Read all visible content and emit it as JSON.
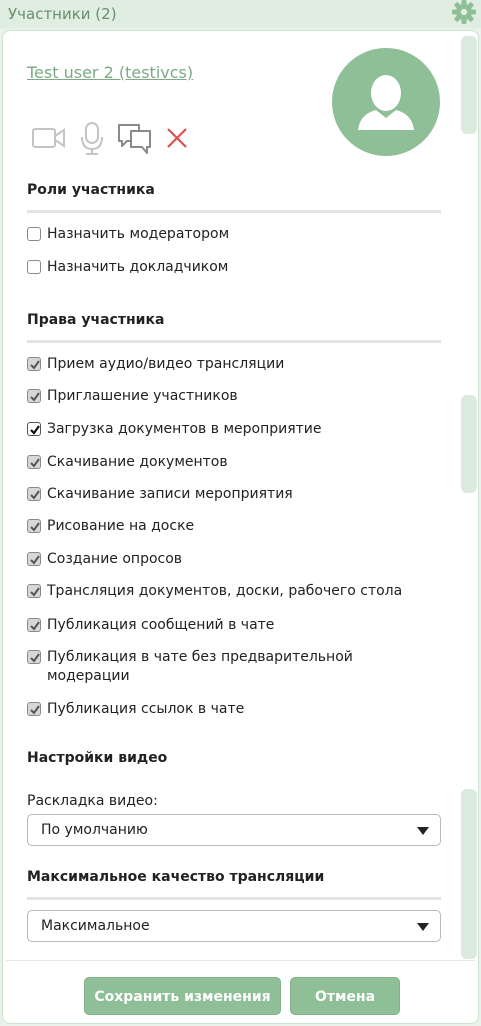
{
  "window": {
    "title": "Участники (2)"
  },
  "user": {
    "name": "Test user 2 (testivcs)"
  },
  "roles": {
    "title": "Роли участника",
    "items": [
      {
        "label": "Назначить модератором",
        "checked": false
      },
      {
        "label": "Назначить докладчиком",
        "checked": false
      }
    ]
  },
  "rights": {
    "title": "Права участника",
    "items": [
      {
        "label": "Прием аудио/видео трансляции",
        "checked": true
      },
      {
        "label": "Приглашение участников",
        "checked": true
      },
      {
        "label": "Загрузка документов в мероприятие",
        "checked": true
      },
      {
        "label": "Скачивание документов",
        "checked": true
      },
      {
        "label": "Скачивание записи мероприятия",
        "checked": true
      },
      {
        "label": "Рисование на доске",
        "checked": true
      },
      {
        "label": "Создание опросов",
        "checked": true
      },
      {
        "label": "Трансляция документов, доски, рабочего стола",
        "checked": true
      },
      {
        "label": "Публикация сообщений в чате",
        "checked": true
      },
      {
        "label": "Публикация в чате без предварительной модерации",
        "checked": true
      },
      {
        "label": "Публикация ссылок в чате",
        "checked": true
      }
    ]
  },
  "video": {
    "title": "Настройки видео",
    "layout_label": "Раскладка видео:",
    "layout_value": "По умолчанию",
    "quality_title": "Максимальное качество трансляции",
    "quality_value": "Максимальное"
  },
  "actions": {
    "save_label": "Сохранить изменения",
    "cancel_label": "Отмена"
  },
  "colors": {
    "accent": "#8fbf96",
    "link": "#7daa86",
    "delete": "#d9534f"
  }
}
